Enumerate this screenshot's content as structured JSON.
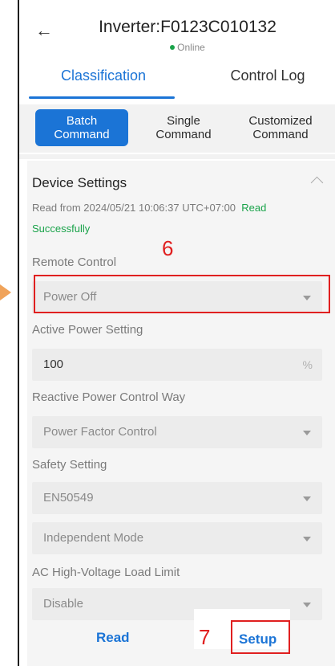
{
  "header": {
    "title": "Inverter:F0123C010132",
    "status": "Online"
  },
  "tabs": [
    {
      "label": "Classification",
      "active": true
    },
    {
      "label": "Control Log",
      "active": false
    }
  ],
  "commands": [
    {
      "label": "Batch\nCommand",
      "active": true
    },
    {
      "label": "Single\nCommand",
      "active": false
    },
    {
      "label": "Customized\nCommand",
      "active": false
    }
  ],
  "section": {
    "title": "Device Settings",
    "read_info": "Read from 2024/05/21 10:06:37 UTC+07:00",
    "read_status": "Read Successfully"
  },
  "fields": {
    "remote_control": {
      "label": "Remote Control",
      "value": "Power Off"
    },
    "active_power": {
      "label": "Active Power Setting",
      "value": "100",
      "unit": "%"
    },
    "reactive_power": {
      "label": "Reactive Power Control Way",
      "value": "Power Factor Control"
    },
    "safety": {
      "label": "Safety Setting",
      "value": "EN50549"
    },
    "mode": {
      "value": "Independent Mode"
    },
    "ac_limit": {
      "label": "AC High-Voltage Load Limit",
      "value": "Disable"
    }
  },
  "annotations": {
    "step6": "6",
    "step7": "7"
  },
  "footer": {
    "read_label": "Read",
    "setup_label": "Setup"
  },
  "colors": {
    "accent": "#1b74d6",
    "success": "#1aa34a",
    "annotation": "#e02020"
  }
}
